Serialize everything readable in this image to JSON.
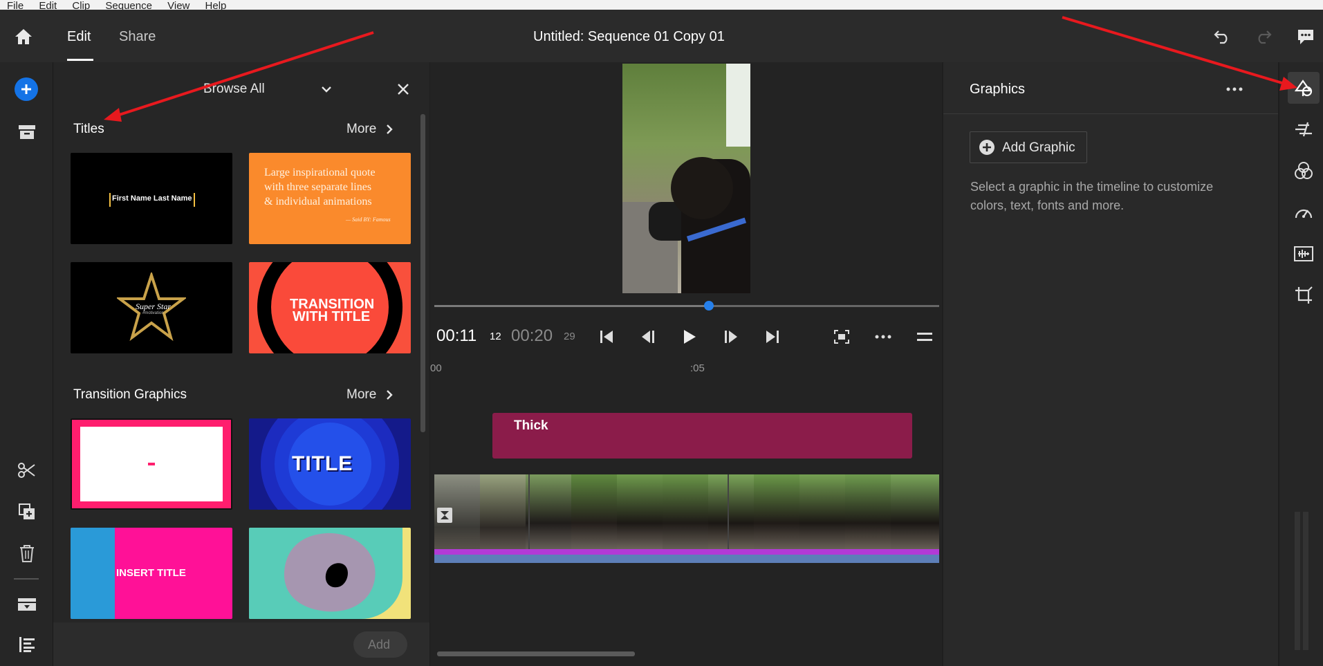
{
  "menu": [
    "File",
    "Edit",
    "Clip",
    "Sequence",
    "View",
    "Help"
  ],
  "topbar": {
    "tab_edit": "Edit",
    "tab_share": "Share",
    "title": "Untitled: Sequence 01 Copy 01"
  },
  "browse": {
    "dropdown_label": "Browse All",
    "titles_heading": "Titles",
    "more_label": "More",
    "transition_heading": "Transition Graphics",
    "add_label": "Add",
    "thumbs": {
      "name": "First Name Last Name",
      "quote_l1": "Large inspirational quote",
      "quote_l2": "with three separate lines",
      "quote_l3": "& individual animations",
      "quote_sig": "— Said BY: Famous",
      "star_l1": "Super Star",
      "star_l2": "#motivation",
      "transition_l1": "TRANSITION",
      "transition_l2": "WITH TITLE",
      "title_word": "TITLE",
      "insert_title": "INSERT TITLE"
    }
  },
  "player": {
    "current_time": "00:11",
    "current_frames": "12",
    "duration": "00:20",
    "duration_frames": "29",
    "playhead_fraction": 0.55,
    "ruler_start": "00",
    "ruler_mark": ":05"
  },
  "timeline": {
    "clip_label": "Thick"
  },
  "graphics": {
    "heading": "Graphics",
    "add_graphic": "Add Graphic",
    "hint_line1": "Select a graphic in the timeline to customize",
    "hint_line2": "colors, text, fonts and more."
  },
  "colors": {
    "accent": "#1473e6",
    "annotation_arrow": "#e8191e",
    "title_clip": "#8b1c4a",
    "audio_bar": "#b23bd6"
  },
  "icons": [
    "home-icon",
    "undo-icon",
    "redo-icon",
    "feedback-icon",
    "add-media-icon",
    "project-icon",
    "scissors-icon",
    "duplicate-icon",
    "trash-icon",
    "tracks-icon",
    "properties-icon",
    "graphics-icon",
    "effects-icon",
    "color-icon",
    "speed-icon",
    "audio-icon",
    "crop-icon"
  ]
}
